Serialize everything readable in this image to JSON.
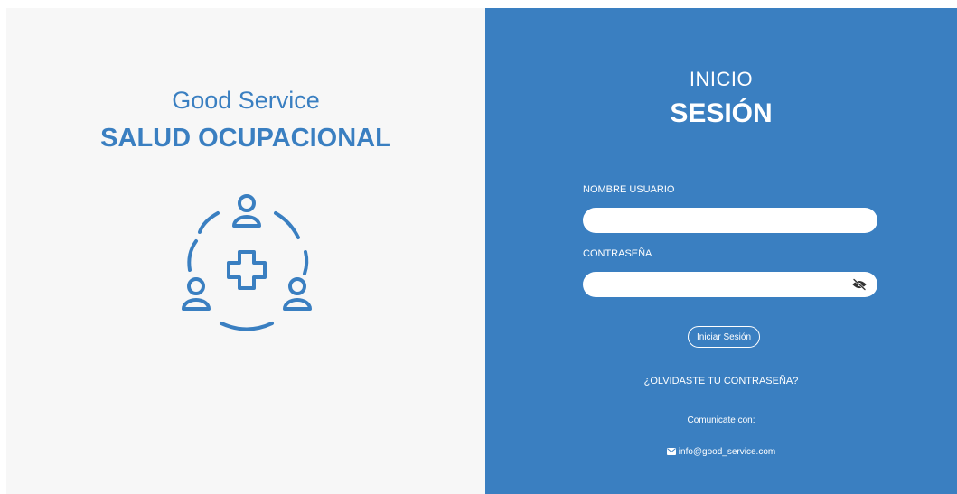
{
  "brand": {
    "name": "Good Service",
    "subtitle": "SALUD OCUPACIONAL",
    "logo_icon": "health-team-icon",
    "color": "#3a7fc1"
  },
  "login": {
    "title_line1": "INICIO",
    "title_line2": "SESIÓN",
    "username_label": "NOMBRE USUARIO",
    "username_value": "",
    "password_label": "CONTRASEÑA",
    "password_value": "",
    "toggle_icon": "eye-slash-icon",
    "submit_label": "Iniciar Sesión",
    "forgot_label": "¿OLVIDASTE TU CONTRASEÑA?",
    "panel_color": "#3a7fc1"
  },
  "contact": {
    "label": "Comunicate con:",
    "email_icon": "envelope-icon",
    "email": "info@good_service.com"
  }
}
